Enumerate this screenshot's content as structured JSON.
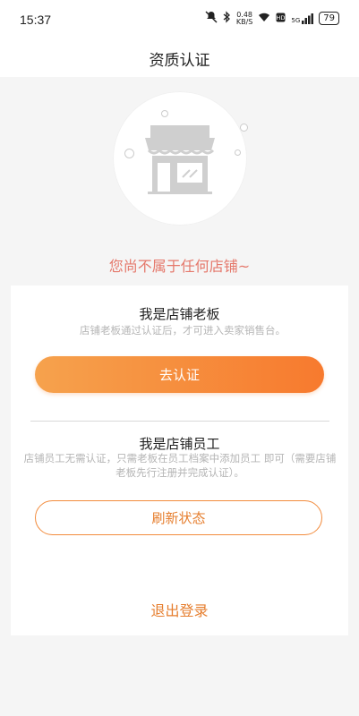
{
  "status_bar": {
    "time": "15:37",
    "net_speed_value": "0.48",
    "net_speed_unit": "KB/S",
    "network_label": "5G",
    "battery": "79"
  },
  "header": {
    "title": "资质认证"
  },
  "hero": {
    "message": "您尚不属于任何店铺~"
  },
  "owner_section": {
    "title": "我是店铺老板",
    "description": "店铺老板通过认证后，才可进入卖家销售台。",
    "button_label": "去认证"
  },
  "employee_section": {
    "title": "我是店铺员工",
    "description": "店铺员工无需认证，只需老板在员工档案中添加员工 即可（需要店铺老板先行注册并完成认证）。",
    "button_label": "刷新状态"
  },
  "logout_label": "退出登录",
  "colors": {
    "accent": "#f77a2e",
    "accent_light": "#f6a24d",
    "headline": "#e5786b"
  },
  "icons": [
    "store-icon",
    "mute-icon",
    "bluetooth-icon",
    "wifi-icon",
    "hd-icon",
    "signal-icon",
    "battery-icon"
  ]
}
